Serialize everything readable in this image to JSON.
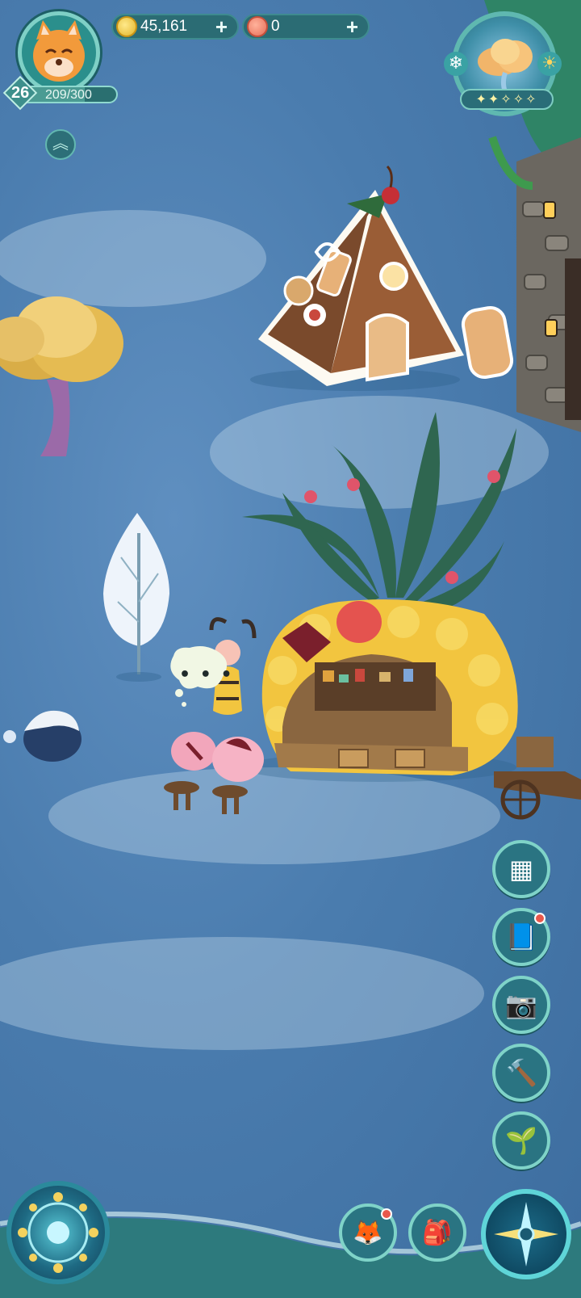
{
  "player": {
    "level": "26",
    "xp_text": "209/300",
    "xp_progress": 0.697,
    "avatar_icon": "fox-avatar-icon"
  },
  "currency": {
    "coins": "45,161",
    "shells": "0",
    "plus_label": "+"
  },
  "weather": {
    "icon": "cloud-weather-icon",
    "stars_filled": 2,
    "stars_total": 5,
    "stars_text": "✦✦✧✧✧"
  },
  "chat_bubble": "• • •",
  "side_menu": [
    {
      "name": "catalog-button",
      "icon": "catalog-icon",
      "glyph": "▦",
      "badge": false
    },
    {
      "name": "guide-book-button",
      "icon": "book-icon",
      "glyph": "📘",
      "badge": true
    },
    {
      "name": "camera-button",
      "icon": "camera-icon",
      "glyph": "📷",
      "badge": false
    },
    {
      "name": "auction-hammer-button",
      "icon": "hammer-icon",
      "glyph": "🔨",
      "badge": false
    },
    {
      "name": "planting-button",
      "icon": "sprout-icon",
      "glyph": "🌱",
      "badge": false
    }
  ],
  "bottom_bar": [
    {
      "name": "pet-button",
      "icon": "fox-icon",
      "glyph": "🦊",
      "badge": true
    },
    {
      "name": "backpack-button",
      "icon": "backpack-icon",
      "glyph": "🎒",
      "badge": false
    }
  ],
  "colors": {
    "accent": "#7fd3c8",
    "hud_bg": "#2a6d78",
    "ground": "#4a7cae"
  }
}
